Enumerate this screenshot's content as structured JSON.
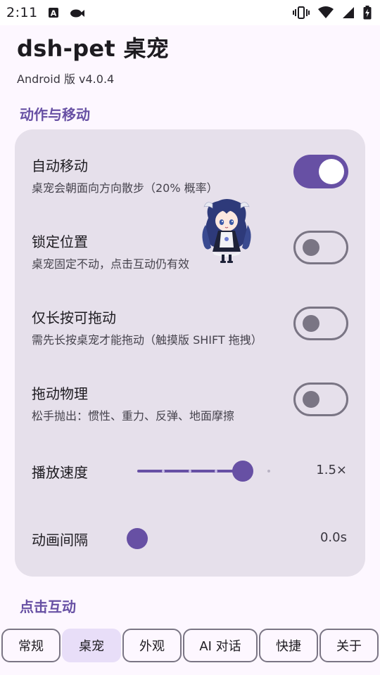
{
  "status_bar": {
    "time": "2:11",
    "icons": [
      "text-a-icon",
      "cloud-icon",
      "vibrate-icon",
      "wifi-icon",
      "signal-icon",
      "battery-charging-icon"
    ]
  },
  "header": {
    "title": "dsh-pet 桌宠",
    "subtitle": "Android 版 v4.0.4"
  },
  "sections": {
    "motion_title": "动作与移动",
    "interaction_title": "点击互动"
  },
  "settings": [
    {
      "title": "自动移动",
      "desc": "桌宠会朝面向方向散步（20% 概率）",
      "enabled": true
    },
    {
      "title": "锁定位置",
      "desc": "桌宠固定不动，点击互动仍有效",
      "enabled": false
    },
    {
      "title": "仅长按可拖动",
      "desc": "需先长按桌宠才能拖动（触摸版 SHIFT 拖拽）",
      "enabled": false
    },
    {
      "title": "拖动物理",
      "desc": "松手抛出：惯性、重力、反弹、地面摩擦",
      "enabled": false
    }
  ],
  "sliders": [
    {
      "label": "播放速度",
      "value_text": "1.5×",
      "level": 0.67,
      "steps": 6
    },
    {
      "label": "动画间隔",
      "value_text": "0.0s",
      "level": 0.0,
      "steps": 0
    }
  ],
  "nav": {
    "tabs": [
      "常规",
      "桌宠",
      "外观",
      "AI 对话",
      "快捷",
      "关于"
    ],
    "active_index": 1
  },
  "colors": {
    "accent": "#6750A4",
    "card": "#E6E0EB",
    "background": "#FDF7FF",
    "active_tab": "#E8DEF8"
  }
}
